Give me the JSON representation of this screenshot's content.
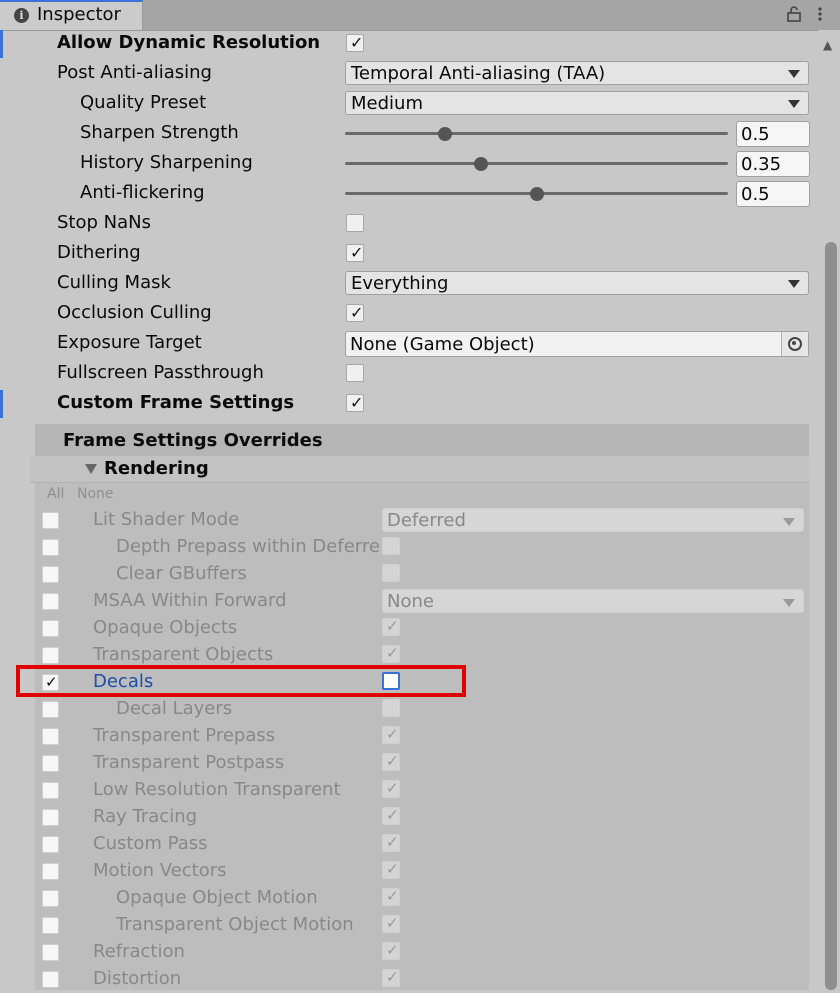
{
  "window": {
    "tab_title": "Inspector"
  },
  "settings": {
    "allow_dynamic_resolution": {
      "label": "Allow Dynamic Resolution",
      "checked": true
    },
    "post_aa": {
      "label": "Post Anti-aliasing",
      "value": "Temporal Anti-aliasing (TAA)"
    },
    "quality_preset": {
      "label": "Quality Preset",
      "value": "Medium"
    },
    "sharpen_strength": {
      "label": "Sharpen Strength",
      "value": "0.5"
    },
    "history_sharpening": {
      "label": "History Sharpening",
      "value": "0.35"
    },
    "anti_flickering": {
      "label": "Anti-flickering",
      "value": "0.5"
    },
    "stop_nans": {
      "label": "Stop NaNs",
      "checked": false
    },
    "dithering": {
      "label": "Dithering",
      "checked": true
    },
    "culling_mask": {
      "label": "Culling Mask",
      "value": "Everything"
    },
    "occlusion_culling": {
      "label": "Occlusion Culling",
      "checked": true
    },
    "exposure_target": {
      "label": "Exposure Target",
      "value": "None (Game Object)"
    },
    "fullscreen_passthrough": {
      "label": "Fullscreen Passthrough",
      "checked": false
    },
    "custom_frame_settings": {
      "label": "Custom Frame Settings",
      "checked": true
    }
  },
  "frame_settings": {
    "title": "Frame Settings Overrides",
    "section": "Rendering",
    "all_label": "All",
    "none_label": "None",
    "rows": [
      {
        "label": "Lit Shader Mode",
        "value": "Deferred"
      },
      {
        "label": "Depth Prepass within Deferred"
      },
      {
        "label": "Clear GBuffers"
      },
      {
        "label": "MSAA Within Forward",
        "value": "None"
      },
      {
        "label": "Opaque Objects"
      },
      {
        "label": "Transparent Objects"
      },
      {
        "label": "Decals"
      },
      {
        "label": "Decal Layers"
      },
      {
        "label": "Transparent Prepass"
      },
      {
        "label": "Transparent Postpass"
      },
      {
        "label": "Low Resolution Transparent"
      },
      {
        "label": "Ray Tracing"
      },
      {
        "label": "Custom Pass"
      },
      {
        "label": "Motion Vectors"
      },
      {
        "label": "Opaque Object Motion"
      },
      {
        "label": "Transparent Object Motion"
      },
      {
        "label": "Refraction"
      },
      {
        "label": "Distortion"
      }
    ]
  },
  "colors": {
    "accent": "#3a72d9",
    "highlight_box": "#e00000",
    "active_label": "#1d4fa8"
  }
}
